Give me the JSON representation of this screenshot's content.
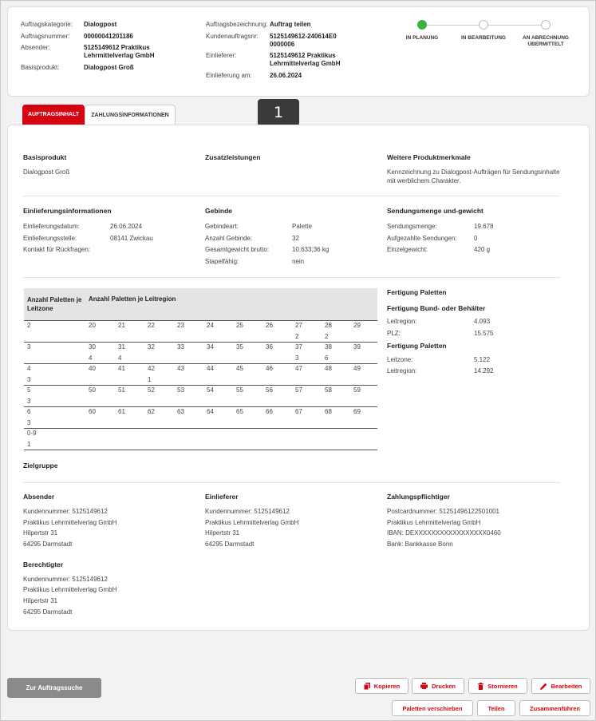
{
  "header": {
    "col1": [
      {
        "label": "Auftragskategorie:",
        "value": "Dialogpost"
      },
      {
        "label": "Auftragsnummer:",
        "value": "00000041201186"
      },
      {
        "label": "Absender:",
        "value": "5125149612 Praktikus Lehrmittelverlag GmbH"
      },
      {
        "label": "Basisprodukt:",
        "value": "Dialogpost Groß"
      }
    ],
    "col2": [
      {
        "label": "Auftragsbezeichnung:",
        "value": "Auftrag teilen"
      },
      {
        "label": "Kundenauftragsnr:",
        "value": "5125149612-240614E00000006"
      },
      {
        "label": "Einlieferer:",
        "value": "5125149612 Praktikus Lehrmittelverlag GmbH"
      },
      {
        "label": "Einlieferung am:",
        "value": "26.06.2024"
      }
    ],
    "steps": [
      "IN PLANUNG",
      "IN BEARBEITUNG",
      "AN ABRECHNUNG ÜBERMITTELT"
    ]
  },
  "tabs": [
    "AUFTRAGSINHALT",
    "ZAHLUNGSINFORMATIONEN"
  ],
  "badge": "1",
  "basisprodukt": {
    "title": "Basisprodukt",
    "value": "Dialogpost Groß"
  },
  "zusatzleistungen": {
    "title": "Zusatzleistungen"
  },
  "weitere": {
    "title": "Weitere Produktmerkmale",
    "text": "Kennzeichnung zu Dialogpost-Aufträgen für Sendungsinhalte mit werblichem Charakter."
  },
  "einlieferung": {
    "title": "Einlieferungsinformationen",
    "rows": [
      {
        "label": "Einlieferungsdatum:",
        "value": "26.06.2024"
      },
      {
        "label": "Einlieferungsstelle:",
        "value": "08141 Zwickau"
      },
      {
        "label": "Kontakt für Rückfragen:",
        "value": ""
      }
    ]
  },
  "gebinde": {
    "title": "Gebinde",
    "rows": [
      {
        "label": "Gebindeart:",
        "value": "Palette"
      },
      {
        "label": "Anzahl Gebinde:",
        "value": "32"
      },
      {
        "label": "Gesamtgewicht brutto:",
        "value": "10.633,36 kg"
      },
      {
        "label": "Stapelfähig:",
        "value": "nein"
      }
    ]
  },
  "sendungsmenge": {
    "title": "Sendungsmenge und-gewicht",
    "rows": [
      {
        "label": "Sendungsmenge:",
        "value": "19.678"
      },
      {
        "label": "Aufgezahlte Sendungen:",
        "value": "0"
      },
      {
        "label": "Einzelgewicht:",
        "value": "420 g"
      }
    ]
  },
  "paletten_table": {
    "header_zone": "Anzahl Paletten je Leitzone",
    "header_region": "Anzahl Paletten je Leitregion",
    "groups": [
      {
        "zone": "2",
        "count": "",
        "regions": [
          "20",
          "21",
          "22",
          "23",
          "24",
          "25",
          "26",
          "27",
          "28",
          "29"
        ],
        "counts": [
          "",
          "",
          "",
          "",
          "",
          "",
          "",
          "2",
          "2",
          ""
        ]
      },
      {
        "zone": "3",
        "count": "",
        "regions": [
          "30",
          "31",
          "32",
          "33",
          "34",
          "35",
          "36",
          "37",
          "38",
          "39"
        ],
        "counts": [
          "4",
          "4",
          "",
          "",
          "",
          "",
          "",
          "3",
          "6",
          ""
        ]
      },
      {
        "zone": "4",
        "count": "3",
        "regions": [
          "40",
          "41",
          "42",
          "43",
          "44",
          "45",
          "46",
          "47",
          "48",
          "49"
        ],
        "counts": [
          "",
          "",
          "1",
          "",
          "",
          "",
          "",
          "",
          "",
          ""
        ]
      },
      {
        "zone": "5",
        "count": "3",
        "regions": [
          "50",
          "51",
          "52",
          "53",
          "54",
          "55",
          "56",
          "57",
          "58",
          "59"
        ],
        "counts": [
          "",
          "",
          "",
          "",
          "",
          "",
          "",
          "",
          "",
          ""
        ]
      },
      {
        "zone": "6",
        "count": "3",
        "regions": [
          "60",
          "61",
          "62",
          "63",
          "64",
          "65",
          "66",
          "67",
          "68",
          "69"
        ],
        "counts": [
          "",
          "",
          "",
          "",
          "",
          "",
          "",
          "",
          "",
          ""
        ]
      },
      {
        "zone": "0-9",
        "count": "1",
        "regions": [],
        "counts": []
      }
    ]
  },
  "fertigung": {
    "title": "Fertigung Paletten",
    "sub1": "Fertigung Bund- oder Behälter",
    "rows1": [
      {
        "label": "Leitregion:",
        "value": "4.093"
      },
      {
        "label": "PLZ:",
        "value": "15.575"
      }
    ],
    "sub2": "Fertigung Paletten",
    "rows2": [
      {
        "label": "Leitzone:",
        "value": "5.122"
      },
      {
        "label": "Leitregion:",
        "value": "14.292"
      }
    ]
  },
  "zielgruppe": {
    "title": "Zielgruppe"
  },
  "absender": {
    "title": "Absender",
    "lines": [
      "Kundennummer: 5125149612",
      "Praktikus Lehrmittelverlag GmbH",
      "Hilpertstr 31",
      "64295 Darmstadt"
    ]
  },
  "einlieferer": {
    "title": "Einlieferer",
    "lines": [
      "Kundennummer: 5125149612",
      "Praktikus Lehrmittelverlag GmbH",
      "Hilpertstr 31",
      "64295 Darmstadt"
    ]
  },
  "zahlungspflichtiger": {
    "title": "Zahlungspflichtiger",
    "lines": [
      "Postcardnummer: 5125149612250100​1",
      "Praktikus Lehrmittelverlag GmbH",
      "IBAN: DEXXXXXXXXXXXXXXXXX0460",
      "Bank: Bankkasse Bonn"
    ]
  },
  "berechtigter": {
    "title": "Berechtigter",
    "lines": [
      "Kundennummer: 5125149612",
      "Praktikus Lehrmittelverlag GmbH",
      "Hilpertstr 31",
      "64295 Darmstadt"
    ]
  },
  "buttons": {
    "search": "Zur Auftragssuche",
    "kopieren": "Kopieren",
    "drucken": "Drucken",
    "stornieren": "Stornieren",
    "bearbeiten": "Bearbeiten",
    "paletten": "Paletten verschieben",
    "teilen": "Teilen",
    "zusammen": "Zusammenführen"
  },
  "colors": {
    "accent": "#d40511",
    "active_step": "#3cb043"
  }
}
